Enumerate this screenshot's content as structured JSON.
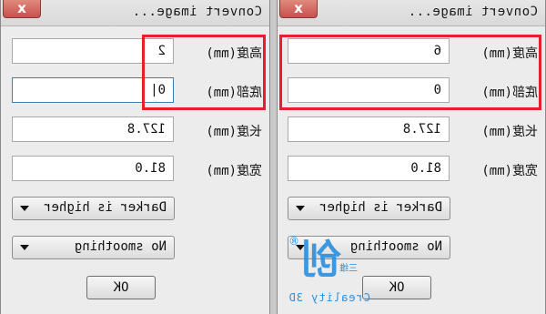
{
  "dialogs": [
    {
      "title": "Convert image...",
      "close_label": "x",
      "fields": [
        {
          "label": "高度(mm)",
          "value": "6"
        },
        {
          "label": "底部(mm)",
          "value": "0"
        },
        {
          "label": "长度(mm)",
          "value": "127.8"
        },
        {
          "label": "宽度(mm)",
          "value": "81.0"
        }
      ],
      "color_mode": "Darker is higher",
      "smoothing": "No smoothing",
      "ok_label": "OK"
    },
    {
      "title": "Convert image...",
      "close_label": "x",
      "fields": [
        {
          "label": "高度(mm)",
          "value": "2"
        },
        {
          "label": "底部(mm)",
          "value": "0|"
        },
        {
          "label": "长度(mm)",
          "value": "127.8"
        },
        {
          "label": "宽度(mm)",
          "value": "81.0"
        }
      ],
      "color_mode": "Darker is higher",
      "smoothing": "No smoothing",
      "ok_label": "OK"
    }
  ],
  "watermark": {
    "glyph": "创",
    "registered": "®",
    "tag": "三维",
    "brand": "Creality 3D"
  },
  "colors": {
    "highlight": "#e8202a",
    "close_button": "#c75050",
    "watermark": "#2a8fe0"
  }
}
